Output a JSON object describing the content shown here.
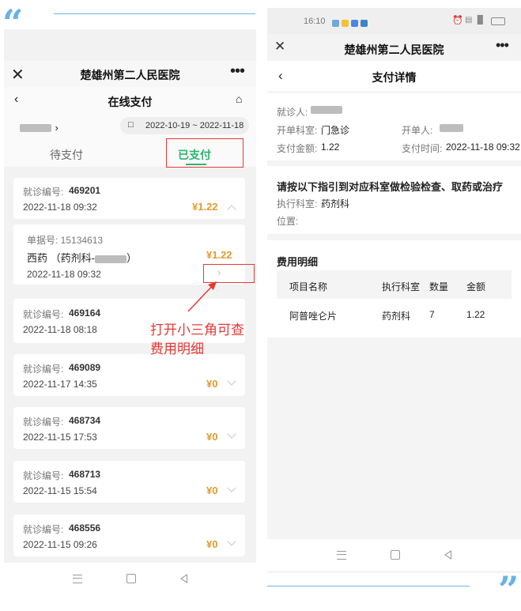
{
  "left": {
    "header_title": "楚雄州第二人民医院",
    "page_title": "在线支付",
    "date_range": "2022-10-19 ~ 2022-11-18",
    "tabs": [
      "待支付",
      "已支付"
    ],
    "records": [
      {
        "label": "就诊编号:",
        "id": "469201",
        "date": "2022-11-18 09:32",
        "amount": "¥1.22"
      },
      {
        "label": "就诊编号:",
        "id": "469164",
        "date": "2022-11-18 08:18",
        "amount": ""
      },
      {
        "label": "就诊编号:",
        "id": "469089",
        "date": "2022-11-17 14:35",
        "amount": "¥0"
      },
      {
        "label": "就诊编号:",
        "id": "468734",
        "date": "2022-11-15 17:53",
        "amount": "¥0"
      },
      {
        "label": "就诊编号:",
        "id": "468713",
        "date": "2022-11-15 15:54",
        "amount": "¥0"
      },
      {
        "label": "就诊编号:",
        "id": "468556",
        "date": "2022-11-15 09:26",
        "amount": "¥0"
      }
    ],
    "detail": {
      "bill_no": "单据号: 15134613",
      "name": "西药 （药剂科-",
      "amount": "¥1.22",
      "date": "2022-11-18 09:32"
    }
  },
  "annotation": {
    "line1": "打开小三角可查",
    "line2": "费用明细",
    "color": "#e53935"
  },
  "right": {
    "status_time": "16:10",
    "header_title": "楚雄州第二人民医院",
    "page_title": "支付详情",
    "patient_label": "就诊人:",
    "dept_label": "开单科室:",
    "dept_value": "门急诊",
    "doctor_label": "开单人:",
    "amount_label": "支付金额:",
    "amount_value": "1.22",
    "time_label": "支付时间:",
    "time_value": "2022-11-18 09:32",
    "guide_title": "请按以下指引到对应科室做检验检查、取药或治疗",
    "exec_label": "执行科室:",
    "exec_value": "药剂科",
    "location_label": "位置:",
    "fee_title": "费用明细",
    "table_headers": [
      "项目名称",
      "执行科室",
      "数量",
      "金额"
    ],
    "table_rows": [
      [
        "阿普唑仑片",
        "药剂科",
        "7",
        "1.22"
      ]
    ]
  },
  "colors": {
    "accent_green": "#2cb46e",
    "amount_orange": "#e39a2c",
    "quote_blue": "#67b3e6"
  }
}
